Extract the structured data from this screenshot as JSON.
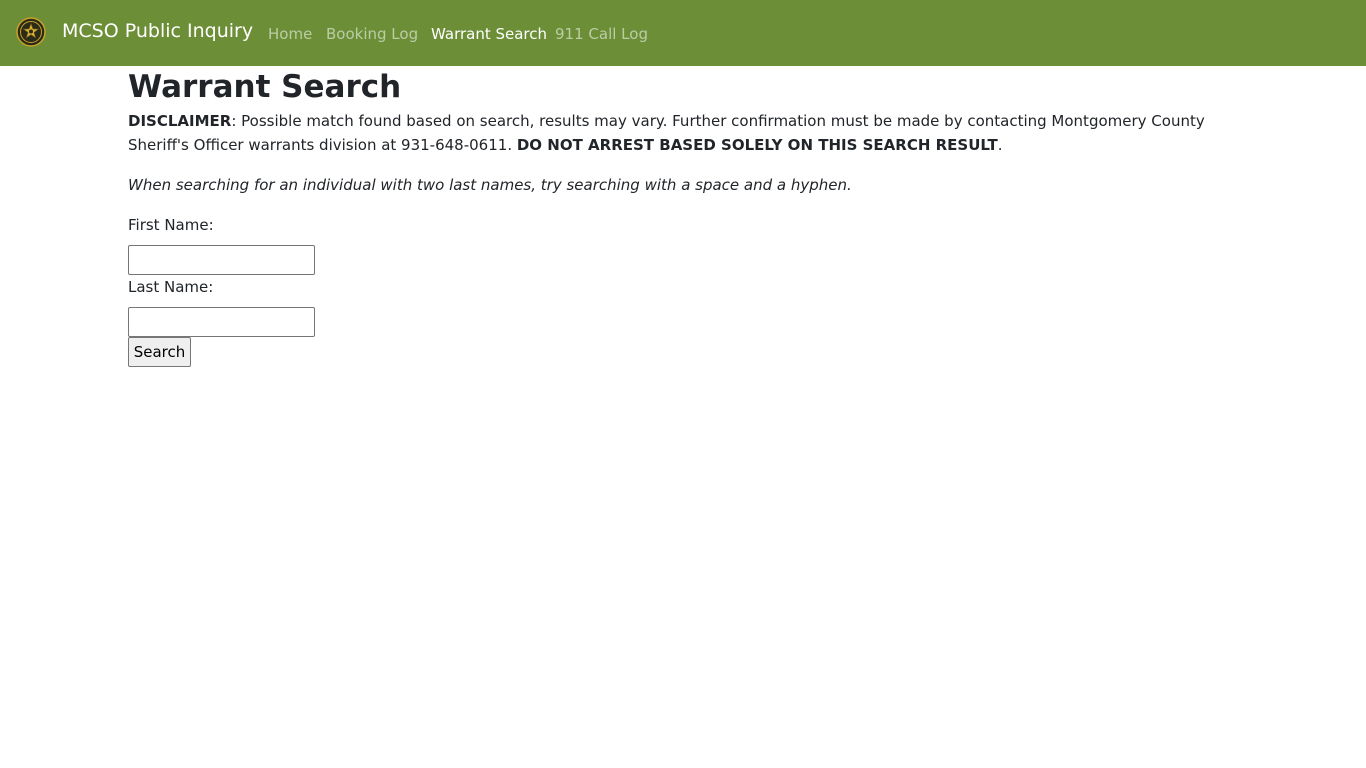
{
  "navbar": {
    "brand": "MCSO Public Inquiry",
    "links": [
      {
        "label": "Home",
        "active": false
      },
      {
        "label": "Booking Log",
        "active": false
      },
      {
        "label": "Warrant Search",
        "active": true
      },
      {
        "label": "911 Call Log",
        "active": false
      }
    ],
    "background_color": "#6b8e37",
    "logo_icon": "sheriff-badge-icon"
  },
  "page": {
    "title": "Warrant Search",
    "disclaimer": {
      "label": "DISCLAIMER",
      "text": ": Possible match found based on search, results may vary. Further confirmation must be made by contacting Montgomery County Sheriff's Officer warrants division at 931-648-0611. ",
      "warning": "DO NOT ARREST BASED SOLELY ON THIS SEARCH RESULT",
      "end": "."
    },
    "hint": "When searching for an individual with two last names, try searching with a space and a hyphen."
  },
  "form": {
    "first_name_label": "First Name:",
    "first_name_value": "",
    "last_name_label": "Last Name:",
    "last_name_value": "",
    "search_label": "Search"
  }
}
